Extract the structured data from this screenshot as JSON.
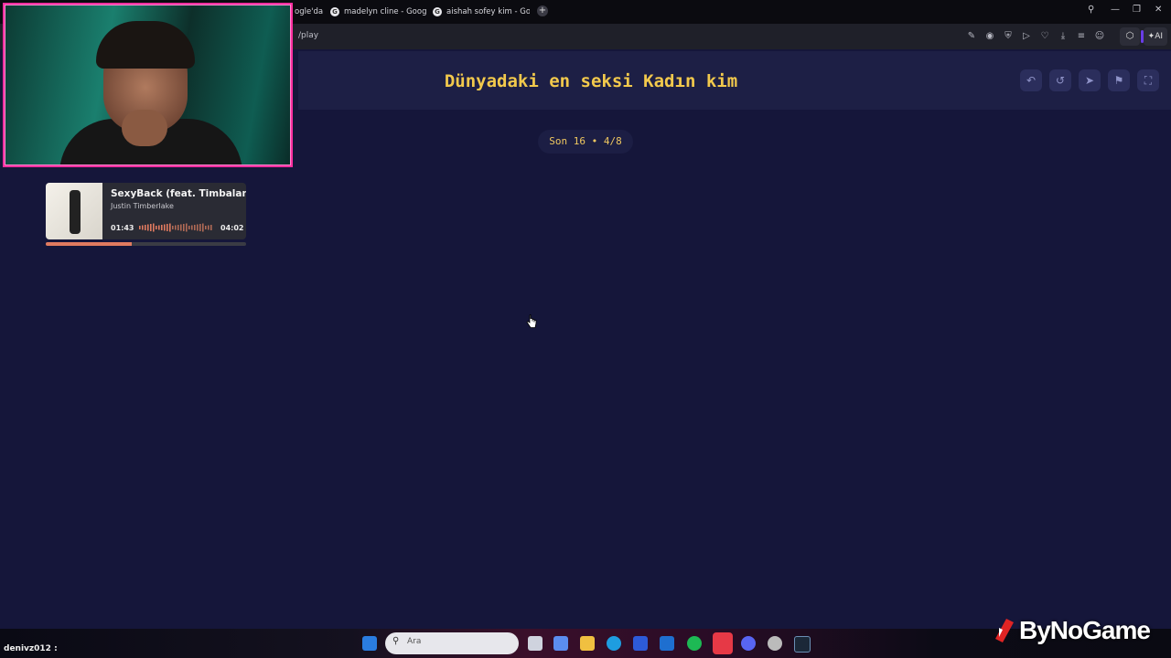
{
  "browser": {
    "tabs": [
      {
        "label": "ogle'da"
      },
      {
        "label": "madelyn cline - Google'da"
      },
      {
        "label": "aishah sofey kim - Google'da"
      }
    ],
    "new_tab": "+",
    "url": "/play",
    "ai_label": "AI"
  },
  "page": {
    "title": "Dünyadaki en seksi Kadın kim",
    "round_info": "Son 16 • 4/8"
  },
  "now_playing": {
    "title": "SexyBack (feat. Timbaland)",
    "artist": "Justin Timberlake",
    "elapsed": "01:43",
    "duration": "04:02",
    "progress": 0.43
  },
  "taskbar": {
    "search_placeholder": "Ara",
    "user_tag": "denivz012 :"
  },
  "watermark": "ByNoGame",
  "colors": {
    "accent": "#f2c94c",
    "webcam_border": "#ff2fa0",
    "progress": "#e07a5f"
  }
}
